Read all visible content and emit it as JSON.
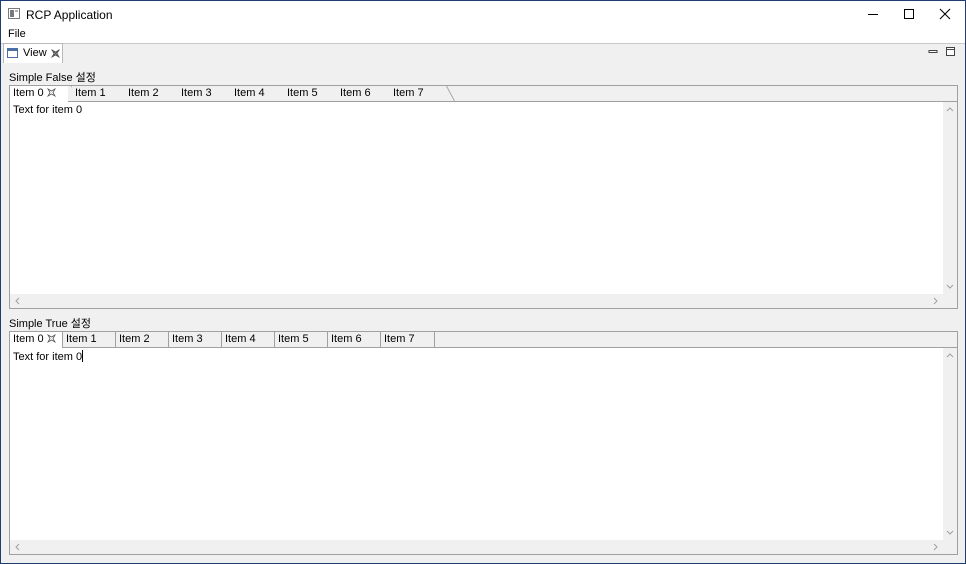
{
  "window": {
    "title": "RCP Application",
    "icon": "app-window-icon"
  },
  "menubar": {
    "file": "File"
  },
  "view_tab": {
    "label": "View",
    "icon": "view-icon"
  },
  "group1": {
    "label": "Simple False 설정",
    "tabs": [
      "Item 0",
      "Item 1",
      "Item 2",
      "Item 3",
      "Item 4",
      "Item 5",
      "Item 6",
      "Item 7"
    ],
    "selected_tab": "Item 0",
    "text": "Text for item 0"
  },
  "group2": {
    "label": "Simple True 설정",
    "tabs": [
      "Item 0",
      "Item 1",
      "Item 2",
      "Item 3",
      "Item 4",
      "Item 5",
      "Item 6",
      "Item 7"
    ],
    "selected_tab": "Item 0",
    "text": "Text for item 0"
  },
  "colors": {
    "window_border": "#1f3c73",
    "background": "#f0f0f0",
    "tab_border": "#a0a0a0"
  }
}
